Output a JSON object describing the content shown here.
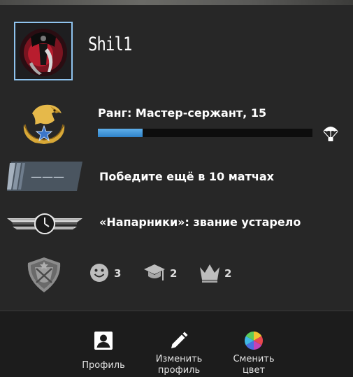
{
  "profile": {
    "username": "Shil1"
  },
  "rank": {
    "text": "Ранг: Мастер-сержант, 15",
    "progress_fraction": 0.21
  },
  "wins": {
    "badge_text": "———",
    "text": "Победите ещё в 10 матчах"
  },
  "wingman": {
    "text": "«Напарники»: звание устарело"
  },
  "commendations": {
    "friendly": "3",
    "teacher": "2",
    "leader": "2"
  },
  "footer": {
    "profile_label": "Профиль",
    "edit_label": "Изменить\nпрофиль",
    "color_label": "Сменить\nцвет"
  },
  "colors": {
    "background": "#262626",
    "progress": "#3b8ed6",
    "avatar_border": "#8fc3ee",
    "footer": "#1c1c1c"
  },
  "icons": {
    "rank": "eagle-star-icon",
    "drop": "parachute-icon",
    "wins": "stripe-badge-icon",
    "wingman": "clock-wings-icon",
    "service": "shield-emblem-icon",
    "friendly": "smiley-icon",
    "teacher": "graduation-cap-icon",
    "leader": "crown-icon",
    "profile": "person-card-icon",
    "edit": "pencil-icon",
    "color": "color-wheel-icon"
  }
}
